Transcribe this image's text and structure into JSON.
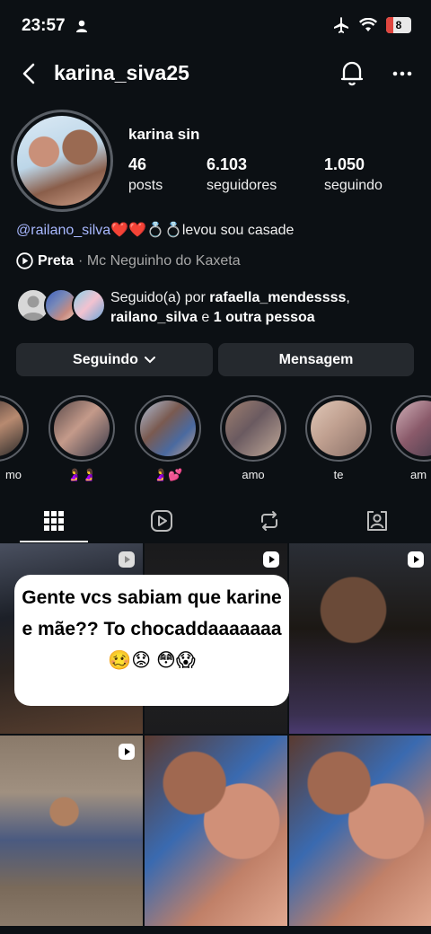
{
  "status_bar": {
    "time": "23:57",
    "battery": "8"
  },
  "header": {
    "username": "karina_siva25"
  },
  "profile": {
    "display_name": "karina sin",
    "stats": [
      {
        "value": "46",
        "label": "posts"
      },
      {
        "value": "6.103",
        "label": "seguidores"
      },
      {
        "value": "1.050",
        "label": "seguindo"
      }
    ],
    "bio": {
      "mention": "@railano_silva",
      "hearts": "❤️❤️",
      "rings": "💍💍",
      "text": "levou sou casade"
    },
    "music": {
      "title": "Preta",
      "separator": " · ",
      "artist": "Mc Neguinho do Kaxeta"
    },
    "followed_by": {
      "prefix": "Seguido(a) por ",
      "user1": "rafaella_mendessss",
      "sep": ",",
      "user2": "railano_silva",
      "mid": " e ",
      "others": "1 outra pessoa"
    }
  },
  "buttons": {
    "following": "Seguindo",
    "message": "Mensagem"
  },
  "highlights": [
    {
      "label": "mo",
      "color": "#5a4a44"
    },
    {
      "label": "🤰🤰",
      "color": "#6f5a56"
    },
    {
      "label": "🤰💕",
      "color": "#4f5f7a"
    },
    {
      "label": "amo",
      "color": "#7a6a64"
    },
    {
      "label": "te",
      "color": "#8a7a70"
    },
    {
      "label": "am",
      "color": "#6a4a5a"
    }
  ],
  "tabs": [
    "grid-icon",
    "reels-icon",
    "reposts-icon",
    "tagged-icon"
  ],
  "post_caption": "Gente vcs sabiam que karine e mãe?? To chocaddaaaaaaa🥴😟 😳😱",
  "colors": {
    "background": "#0c1014",
    "button": "#25292e",
    "mention": "#a8b8ff",
    "muted": "#a8a8a8"
  }
}
